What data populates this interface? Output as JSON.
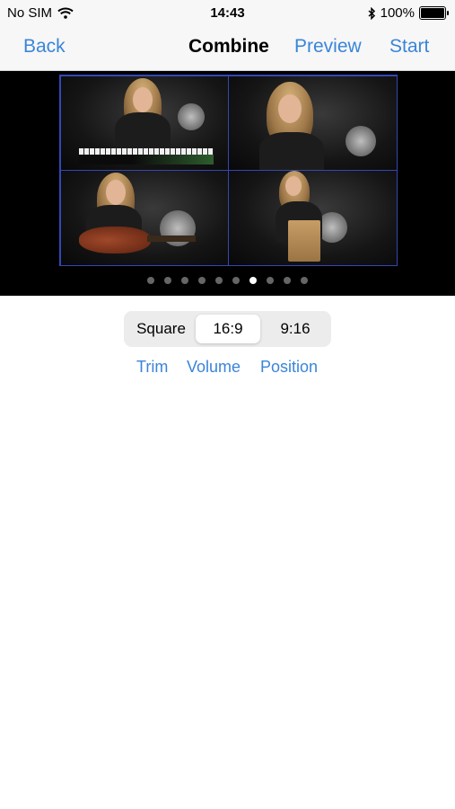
{
  "status_bar": {
    "carrier": "No SIM",
    "time": "14:43",
    "battery": "100%",
    "icons": [
      "wifi-icon",
      "bluetooth-icon",
      "battery-icon"
    ]
  },
  "navbar": {
    "back": "Back",
    "title": "Combine",
    "preview": "Preview",
    "start": "Start"
  },
  "preview": {
    "tiles": [
      "keyboard-performer",
      "singer",
      "guitar-performer",
      "cajon-performer"
    ],
    "page_count": 10,
    "current_page": 7
  },
  "aspect_control": {
    "options": [
      "Square",
      "16:9",
      "9:16"
    ],
    "selected": "16:9"
  },
  "edit_links": {
    "trim": "Trim",
    "volume": "Volume",
    "position": "Position"
  },
  "colors": {
    "accent": "#3a85d9",
    "grid_border": "#3447b5",
    "video_bg": "#000000"
  }
}
